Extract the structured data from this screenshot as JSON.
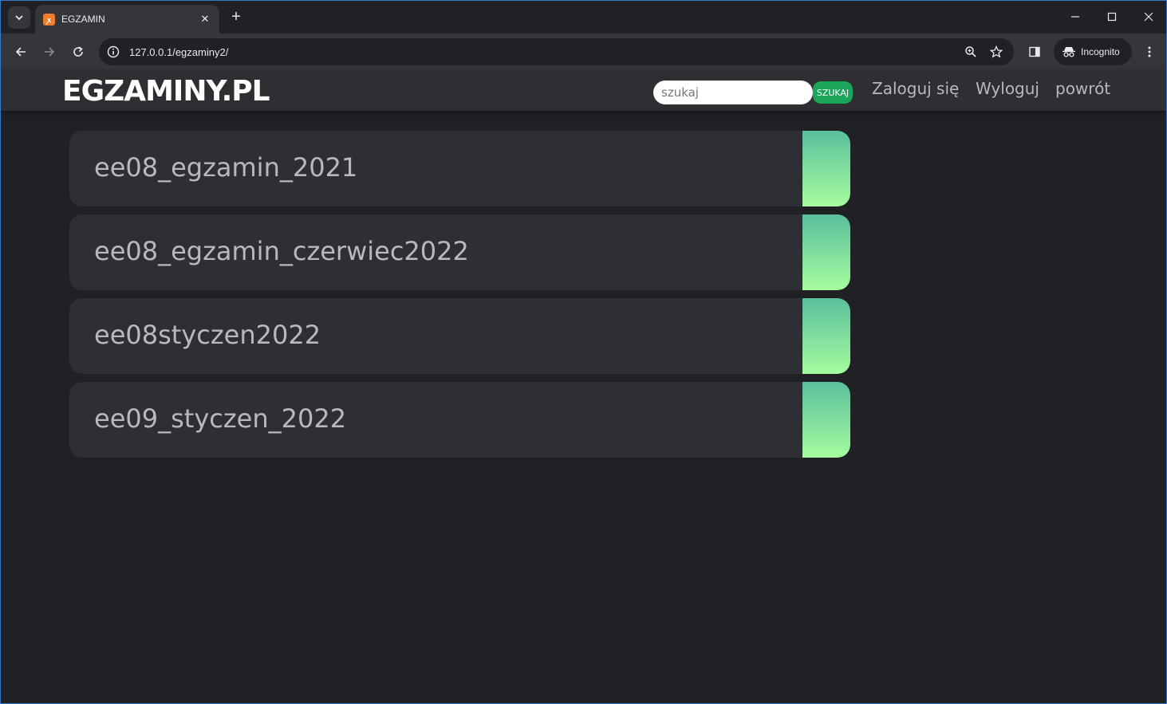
{
  "browser": {
    "tab_title": "EGZAMIN",
    "url": "127.0.0.1/egzaminy2/",
    "incognito_label": "Incognito"
  },
  "site": {
    "logo": "EGZAMINY.PL",
    "search_placeholder": "szukaj",
    "search_button": "SZUKAJ",
    "nav": {
      "login": "Zaloguj się",
      "logout": "Wyloguj",
      "back": "powrót"
    }
  },
  "exams": [
    {
      "title": "ee08_egzamin_2021"
    },
    {
      "title": "ee08_egzamin_czerwiec2022"
    },
    {
      "title": "ee08styczen2022"
    },
    {
      "title": "ee09_styczen_2022"
    }
  ],
  "colors": {
    "accent_top": "#5abf9c",
    "accent_bottom": "#a6fc9f",
    "search_button": "#1aa55a",
    "page_bg": "#202124",
    "card_bg": "#2e2f34"
  }
}
